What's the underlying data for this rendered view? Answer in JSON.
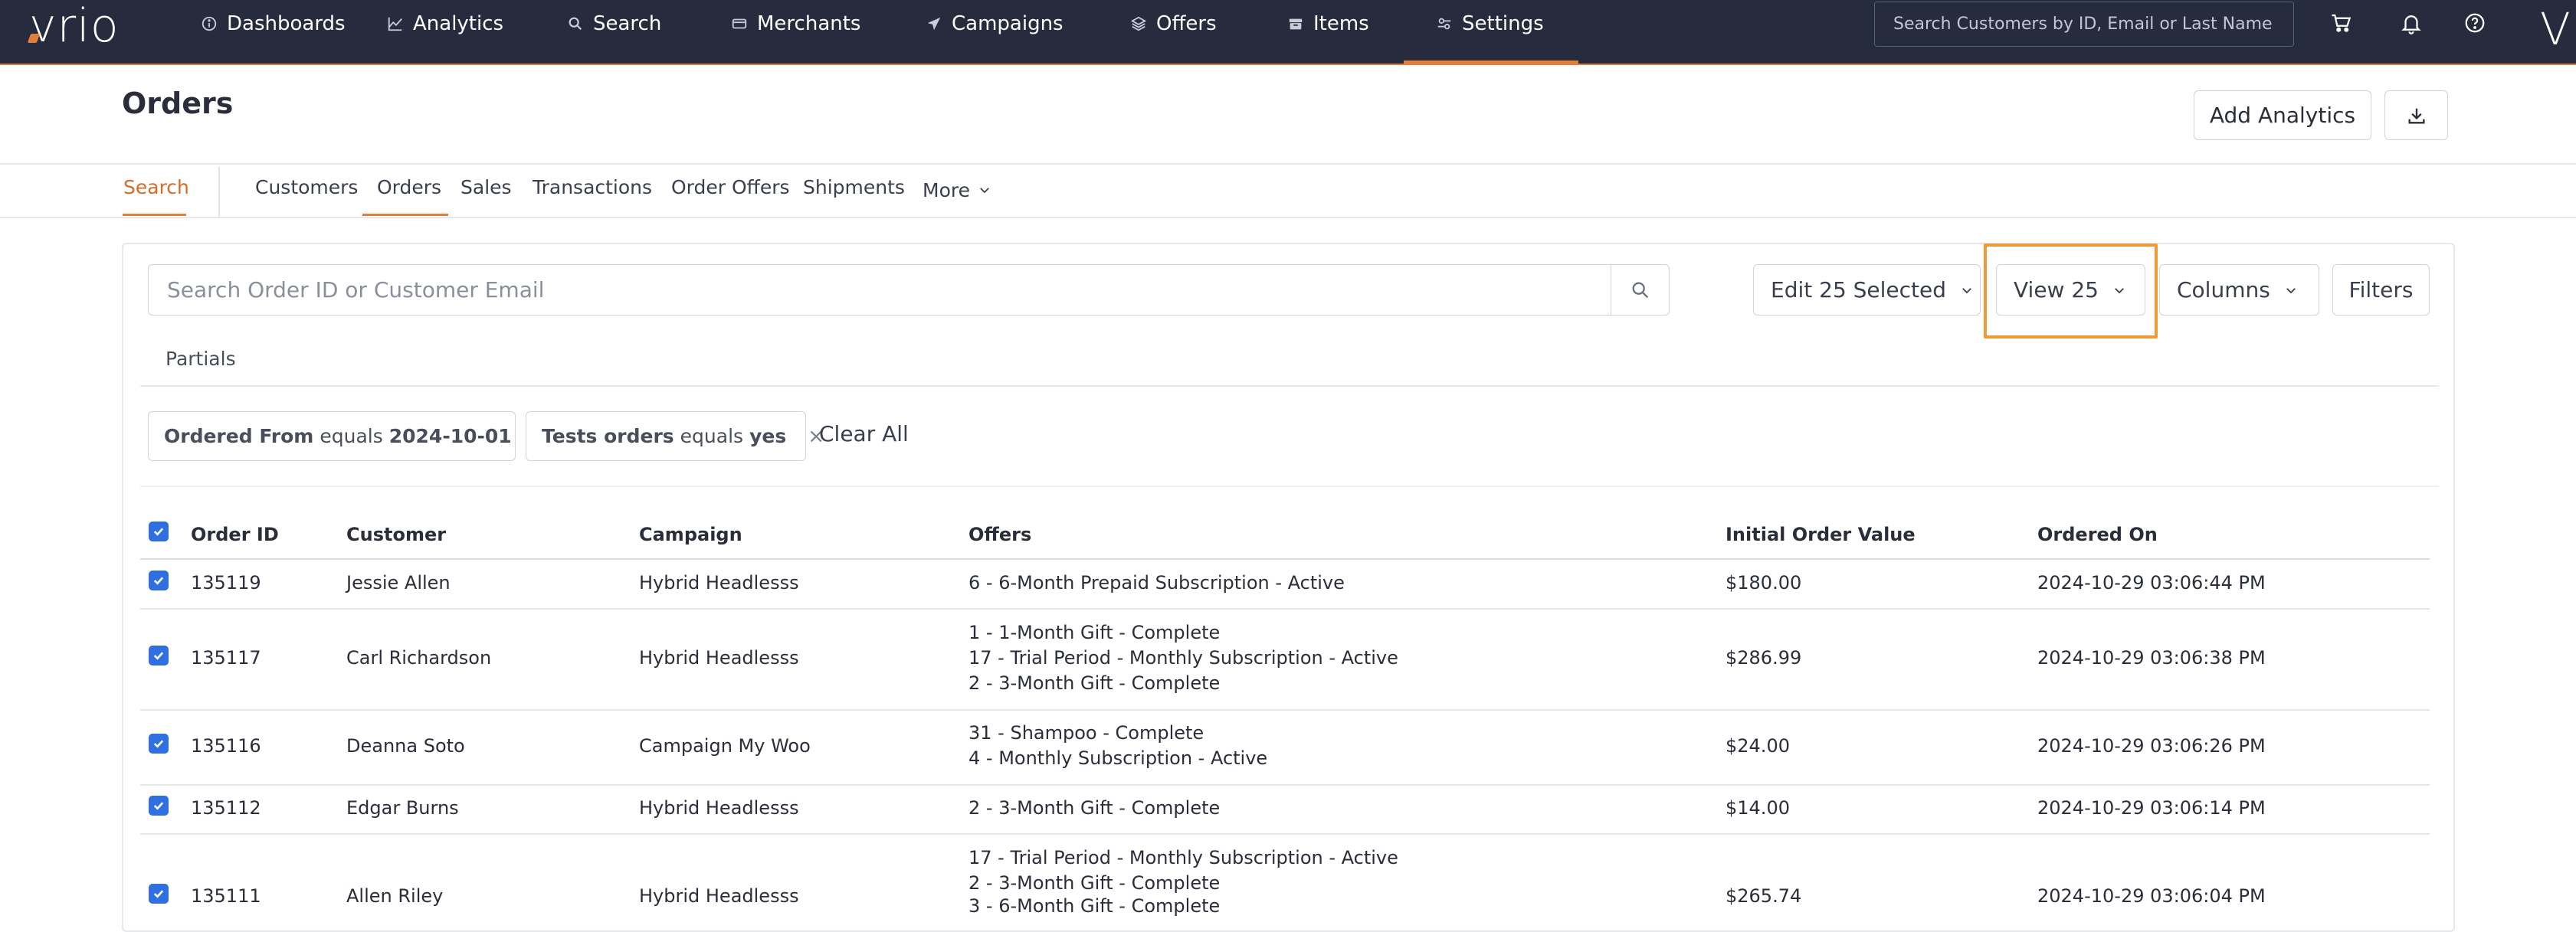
{
  "nav": {
    "logo": "vrio",
    "items": [
      {
        "label": "Dashboards",
        "icon": "info-circle-icon"
      },
      {
        "label": "Analytics",
        "icon": "trend-line-icon"
      },
      {
        "label": "Search",
        "icon": "magnifier-icon"
      },
      {
        "label": "Merchants",
        "icon": "credit-card-icon"
      },
      {
        "label": "Campaigns",
        "icon": "paper-plane-icon"
      },
      {
        "label": "Offers",
        "icon": "layers-icon"
      },
      {
        "label": "Items",
        "icon": "box-icon"
      },
      {
        "label": "Settings",
        "icon": "sliders-icon"
      }
    ],
    "active": "Settings",
    "search_placeholder": "Search Customers by ID, Email or Last Name",
    "right_icons": [
      "cart-icon",
      "bell-icon",
      "help-icon"
    ],
    "user_initial": "V",
    "colors": {
      "bg": "#262b3e",
      "accent": "#e47f3a"
    }
  },
  "header": {
    "title": "Orders",
    "add_analytics_label": "Add Analytics",
    "download_icon": "download-icon"
  },
  "subtabs": {
    "search_label": "Search",
    "items": [
      "Customers",
      "Orders",
      "Sales",
      "Transactions",
      "Order Offers",
      "Shipments",
      "More"
    ],
    "active": "Orders"
  },
  "toolbar": {
    "search_placeholder": "Search Order ID or Customer Email",
    "edit_selected_label": "Edit 25 Selected",
    "view_label": "View 25",
    "columns_label": "Columns",
    "filters_label": "Filters"
  },
  "partials_label": "Partials",
  "filters": {
    "chips": [
      {
        "field": "Ordered From",
        "op": "equals",
        "value": "2024-10-01"
      },
      {
        "field": "Tests orders",
        "op": "equals",
        "value": "yes"
      }
    ],
    "clear_all_label": "Clear All"
  },
  "table": {
    "columns": [
      "Order ID",
      "Customer",
      "Campaign",
      "Offers",
      "Initial Order Value",
      "Ordered On"
    ],
    "rows": [
      {
        "id": "135119",
        "customer": "Jessie Allen",
        "campaign": "Hybrid Headlesss",
        "offers": [
          "6 - 6-Month Prepaid Subscription - Active"
        ],
        "value": "$180.00",
        "ordered_on": "2024-10-29 03:06:44 PM",
        "checked": true
      },
      {
        "id": "135117",
        "customer": "Carl Richardson",
        "campaign": "Hybrid Headlesss",
        "offers": [
          "1 - 1-Month Gift - Complete",
          "17 - Trial Period - Monthly Subscription - Active",
          "2 - 3-Month Gift - Complete"
        ],
        "value": "$286.99",
        "ordered_on": "2024-10-29 03:06:38 PM",
        "checked": true
      },
      {
        "id": "135116",
        "customer": "Deanna Soto",
        "campaign": "Campaign My Woo",
        "offers": [
          "31 - Shampoo - Complete",
          "4 - Monthly Subscription - Active"
        ],
        "value": "$24.00",
        "ordered_on": "2024-10-29 03:06:26 PM",
        "checked": true
      },
      {
        "id": "135112",
        "customer": "Edgar Burns",
        "campaign": "Hybrid Headlesss",
        "offers": [
          "2 - 3-Month Gift - Complete"
        ],
        "value": "$14.00",
        "ordered_on": "2024-10-29 03:06:14 PM",
        "checked": true
      },
      {
        "id": "135111",
        "customer": "Allen Riley",
        "campaign": "Hybrid Headlesss",
        "offers": [
          "17 - Trial Period - Monthly Subscription - Active",
          "2 - 3-Month Gift - Complete",
          "3 - 6-Month Gift - Complete"
        ],
        "value": "$265.74",
        "ordered_on": "2024-10-29 03:06:04 PM",
        "checked": true
      }
    ]
  }
}
